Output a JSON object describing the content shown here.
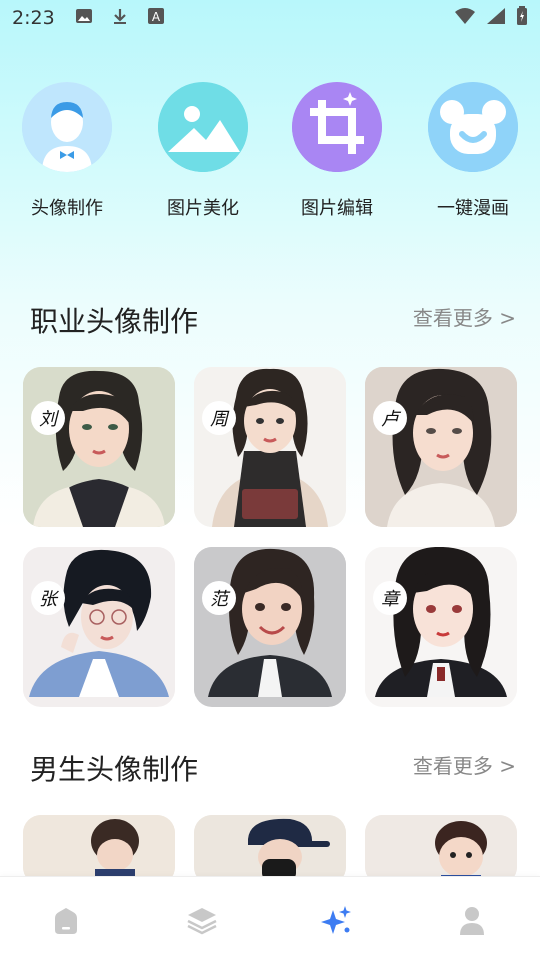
{
  "status_bar": {
    "time": "2:23"
  },
  "quick_tools": [
    {
      "label": "头像制作",
      "icon": "avatar-maker-icon"
    },
    {
      "label": "图片美化",
      "icon": "image-beautify-icon"
    },
    {
      "label": "图片编辑",
      "icon": "crop-edit-icon"
    },
    {
      "label": "一键漫画",
      "icon": "bear-comic-icon"
    }
  ],
  "professional": {
    "title": "职业头像制作",
    "more": "查看更多 >",
    "items": [
      {
        "badge": "刘"
      },
      {
        "badge": "周"
      },
      {
        "badge": "卢"
      },
      {
        "badge": "张"
      },
      {
        "badge": "范"
      },
      {
        "badge": "章"
      }
    ]
  },
  "male": {
    "title": "男生头像制作",
    "more": "查看更多 >"
  },
  "bottom_nav": [
    {
      "icon": "home-icon",
      "active": false
    },
    {
      "icon": "layers-icon",
      "active": false
    },
    {
      "icon": "sparkle-icon",
      "active": true
    },
    {
      "icon": "profile-icon",
      "active": false
    }
  ],
  "colors": {
    "accent": "#3d7cf2",
    "inactive": "#c8c8c8"
  }
}
